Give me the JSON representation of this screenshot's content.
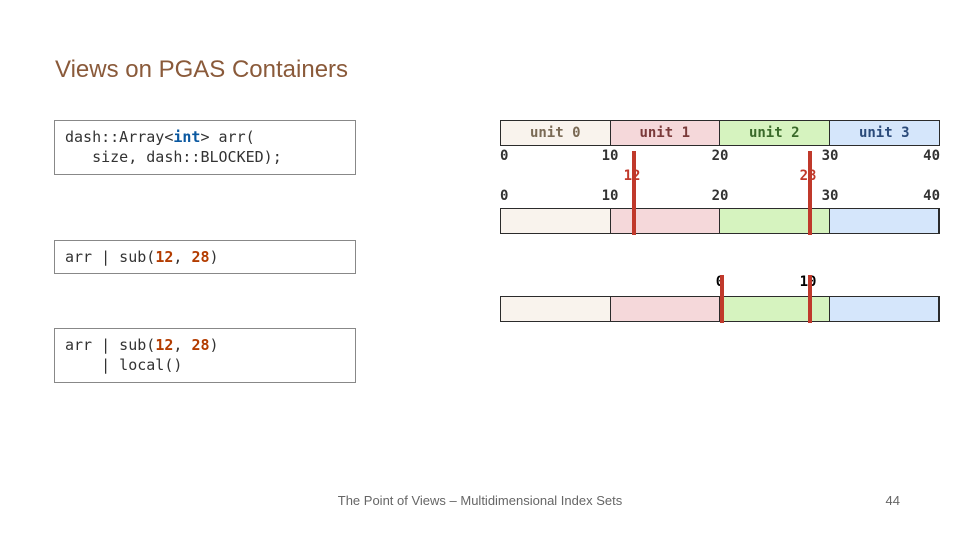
{
  "title": "Views on PGAS Containers",
  "code1_a": "dash::Array<",
  "code1_b": "int",
  "code1_c": "> arr(\n   size, dash::BLOCKED);",
  "code2_a": "arr | sub(",
  "code2_b": "12",
  "code2_c": ", ",
  "code2_d": "28",
  "code2_e": ")",
  "code3_a": "arr | sub(",
  "code3_b": "12",
  "code3_c": ", ",
  "code3_d": "28",
  "code3_e": ")\n    | local()",
  "units": [
    "unit 0",
    "unit 1",
    "unit 2",
    "unit 3"
  ],
  "ticks": [
    "0",
    "10",
    "20",
    "30",
    "40"
  ],
  "sub_lo": "12",
  "sub_hi": "28",
  "row2_ticks": [
    "0",
    "10",
    "20",
    "30",
    "40"
  ],
  "local_lo": "0",
  "local_hi": "10",
  "footer": "The Point of Views – Multidimensional Index Sets",
  "page": "44"
}
